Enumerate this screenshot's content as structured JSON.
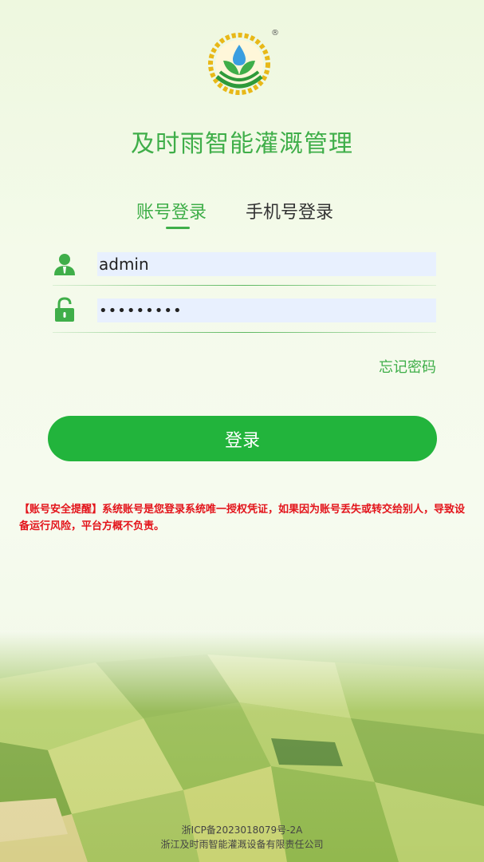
{
  "app": {
    "title": "及时雨智能灌溉管理",
    "registered_mark": "®"
  },
  "tabs": {
    "account": "账号登录",
    "phone": "手机号登录"
  },
  "form": {
    "username_value": "admin",
    "password_value": "•••••••••",
    "forgot_password": "忘记密码",
    "login_button": "登录"
  },
  "notice": "【账号安全提醒】系统账号是您登录系统唯一授权凭证，如果因为账号丢失或转交给别人，导致设备运行风险，平台方概不负责。",
  "footer": {
    "icp": "浙ICP备2023018079号-2A",
    "company": "浙江及时雨智能灌溉设备有限责任公司"
  },
  "colors": {
    "brand_green": "#3fae49",
    "button_green": "#22b43c",
    "warning_red": "#e3141b"
  },
  "icons": [
    "logo",
    "user-icon",
    "lock-icon"
  ]
}
